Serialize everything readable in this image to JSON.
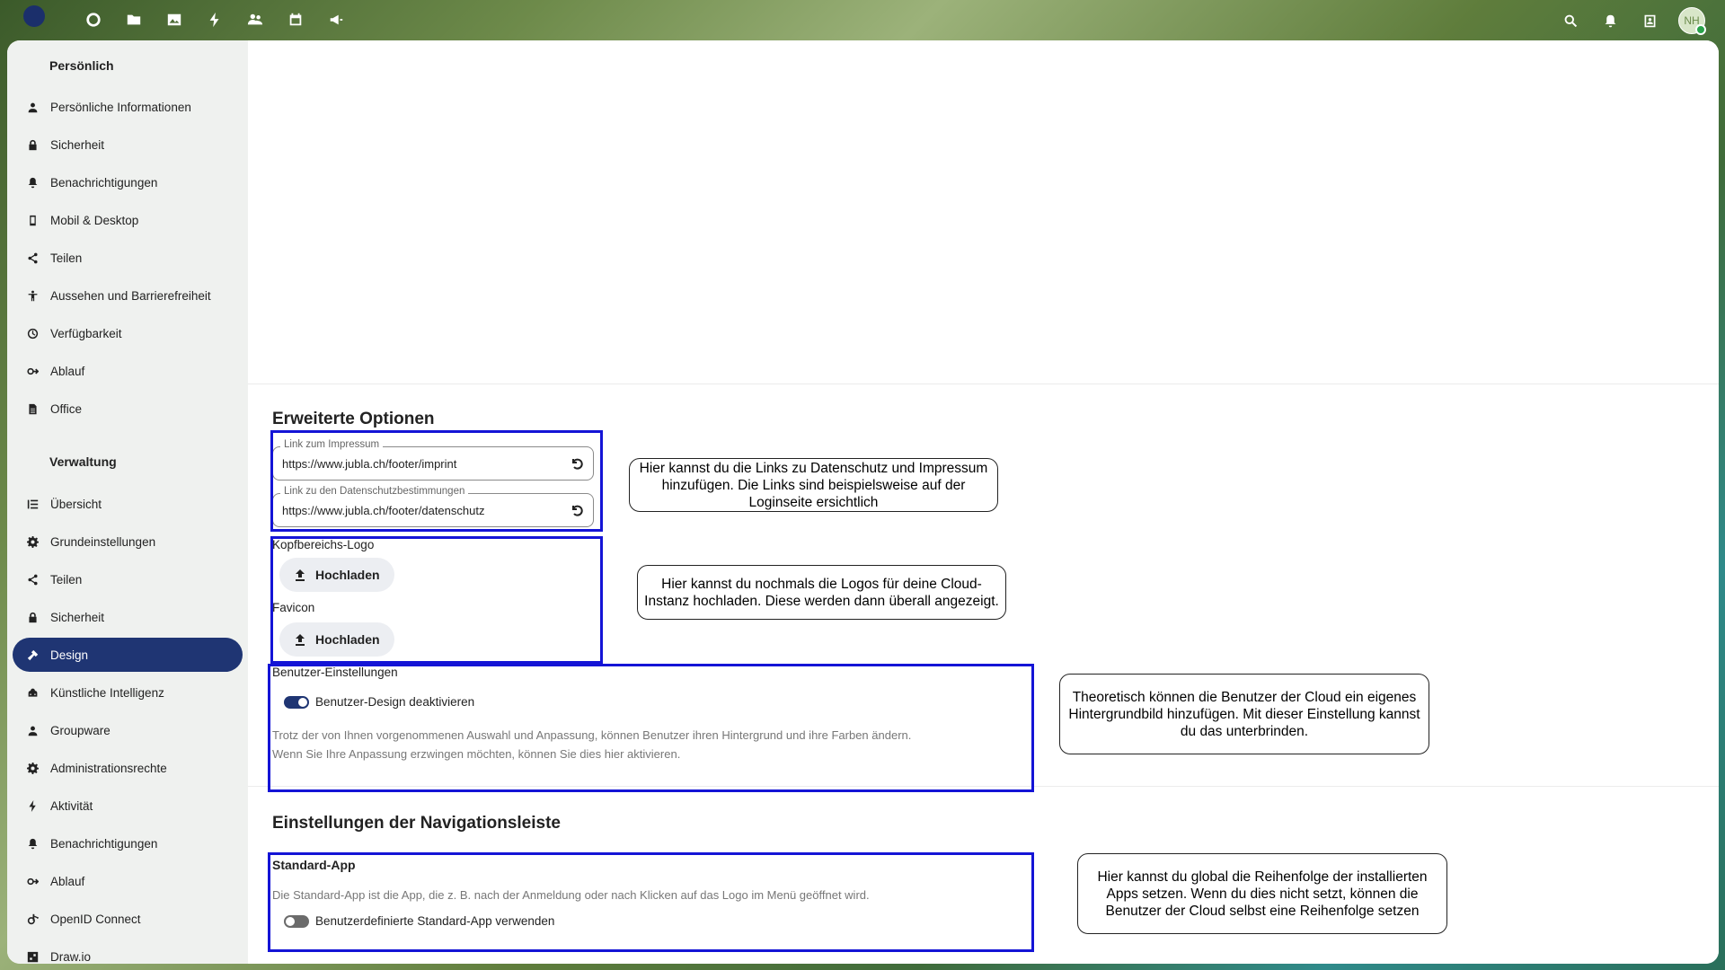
{
  "topbar": {
    "apps": [
      "dashboard-icon",
      "files-icon",
      "photos-icon",
      "activity-icon",
      "contacts-icon",
      "calendar-icon",
      "announcements-icon"
    ],
    "right": [
      "search-icon",
      "notifications-icon",
      "contacts-menu-icon"
    ],
    "avatar_initials": "NH"
  },
  "sidebar": {
    "personal_heading": "Persönlich",
    "personal_items": [
      {
        "label": "Persönliche Informationen",
        "icon": "user-icon"
      },
      {
        "label": "Sicherheit",
        "icon": "lock-icon"
      },
      {
        "label": "Benachrichtigungen",
        "icon": "bell-icon"
      },
      {
        "label": "Mobil & Desktop",
        "icon": "phone-icon"
      },
      {
        "label": "Teilen",
        "icon": "share-icon"
      },
      {
        "label": "Aussehen und Barrierefreiheit",
        "icon": "accessibility-icon"
      },
      {
        "label": "Verfügbarkeit",
        "icon": "clock-icon"
      },
      {
        "label": "Ablauf",
        "icon": "flow-icon"
      },
      {
        "label": "Office",
        "icon": "document-icon"
      }
    ],
    "admin_heading": "Verwaltung",
    "admin_items": [
      {
        "label": "Übersicht",
        "icon": "list-icon"
      },
      {
        "label": "Grundeinstellungen",
        "icon": "gear-icon"
      },
      {
        "label": "Teilen",
        "icon": "share-icon"
      },
      {
        "label": "Sicherheit",
        "icon": "lock-icon"
      },
      {
        "label": "Design",
        "icon": "paint-icon",
        "active": true
      },
      {
        "label": "Künstliche Intelligenz",
        "icon": "ai-icon"
      },
      {
        "label": "Groupware",
        "icon": "groupware-icon"
      },
      {
        "label": "Administrationsrechte",
        "icon": "admin-gear-icon"
      },
      {
        "label": "Aktivität",
        "icon": "bolt-icon"
      },
      {
        "label": "Benachrichtigungen",
        "icon": "bell-icon"
      },
      {
        "label": "Ablauf",
        "icon": "flow-icon"
      },
      {
        "label": "OpenID Connect",
        "icon": "openid-icon"
      },
      {
        "label": "Draw.io",
        "icon": "drawio-icon"
      }
    ]
  },
  "main": {
    "advanced_title": "Erweiterte Optionen",
    "imprint": {
      "label": "Link zum Impressum",
      "value": "https://www.jubla.ch/footer/imprint"
    },
    "privacy": {
      "label": "Link zu den Datenschutzbestimmungen",
      "value": "https://www.jubla.ch/footer/datenschutz"
    },
    "header_logo_label": "Kopfbereichs-Logo",
    "favicon_label": "Favicon",
    "upload_label": "Hochladen",
    "user_settings_label": "Benutzer-Einstellungen",
    "disable_user_theming": {
      "label": "Benutzer-Design deaktivieren",
      "enabled": true
    },
    "user_settings_hint_1": "Trotz der von Ihnen vorgenommenen Auswahl und Anpassung, können Benutzer ihren Hintergrund und ihre Farben ändern.",
    "user_settings_hint_2": "Wenn Sie Ihre Anpassung erzwingen möchten, können Sie dies hier aktivieren.",
    "nav_title": "Einstellungen der Navigationsleiste",
    "default_app_title": "Standard-App",
    "default_app_hint": "Die Standard-App ist die App, die z. B. nach der Anmeldung oder nach Klicken auf das Logo im Menü geöffnet wird.",
    "custom_default_app": {
      "label": "Benutzerdefinierte Standard-App verwenden",
      "enabled": false
    }
  },
  "callouts": {
    "links": [
      "Hier kannst du die Links zu Datenschutz und Impressum",
      "hinzufügen. Die Links sind beispielsweise auf der",
      "Loginseite ersichtlich"
    ],
    "logos": [
      "Hier kannst du nochmals die Logos für deine Cloud-",
      "Instanz hochladen. Diese werden dann überall angezeigt."
    ],
    "background": [
      "Theoretisch können die Benutzer der Cloud ein eigenes",
      "Hintergrundbild hinzufügen. Mit dieser Einstellung kannst",
      "du das unterbrinden."
    ],
    "order": [
      "Hier kannst du global die Reihenfolge der installierten",
      "Apps setzen. Wenn du dies nicht setzt, können die",
      "Benutzer der Cloud selbst eine Reihenfolge setzen"
    ]
  },
  "colors": {
    "accent": "#1f3573",
    "annotation_border": "#1414d6"
  }
}
